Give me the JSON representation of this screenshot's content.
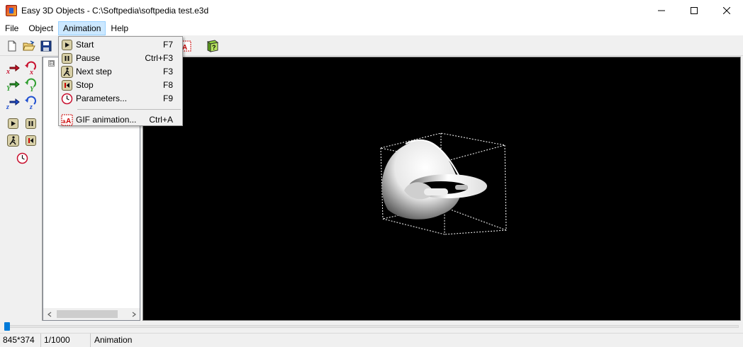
{
  "window": {
    "title": "Easy 3D Objects - C:\\Softpedia\\softpedia test.e3d",
    "minimize": "—",
    "maximize": "☐",
    "close": "✕"
  },
  "menubar": {
    "items": [
      "File",
      "Object",
      "Animation",
      "Help"
    ],
    "active_index": 2
  },
  "animation_menu": {
    "items": [
      {
        "label": "Start",
        "shortcut": "F7",
        "icon": "play-icon"
      },
      {
        "label": "Pause",
        "shortcut": "Ctrl+F3",
        "icon": "pause-icon"
      },
      {
        "label": "Next step",
        "shortcut": "F3",
        "icon": "walk-icon"
      },
      {
        "label": "Stop",
        "shortcut": "F8",
        "icon": "stop-icon"
      },
      {
        "label": "Parameters...",
        "shortcut": "F9",
        "icon": "clock-icon"
      }
    ],
    "gif": {
      "label": "GIF animation...",
      "shortcut": "Ctrl+A",
      "icon": "gif-icon"
    }
  },
  "tree": {
    "expander": "⊟"
  },
  "slider": {
    "position": 0.0
  },
  "status": {
    "dimensions": "845*374",
    "frame": "1/1000",
    "mode": "Animation"
  },
  "colors": {
    "accent": "#007ad9",
    "menu_highlight": "#cce8ff",
    "viewport_bg": "#000000"
  }
}
